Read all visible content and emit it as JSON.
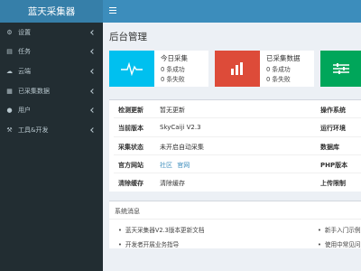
{
  "app": {
    "title": "蓝天采集器"
  },
  "sidebar": {
    "items": [
      {
        "label": "设置",
        "icon": "⚙",
        "icon_name": "gear-icon"
      },
      {
        "label": "任务",
        "icon": "▤",
        "icon_name": "tasks-icon"
      },
      {
        "label": "云端",
        "icon": "☁",
        "icon_name": "cloud-icon"
      },
      {
        "label": "已采集数据",
        "icon": "▦",
        "icon_name": "database-icon"
      },
      {
        "label": "用户",
        "icon": "●",
        "icon_name": "user-icon"
      },
      {
        "label": "工具&开发",
        "icon": "⚒",
        "icon_name": "tools-icon"
      }
    ]
  },
  "main": {
    "page_title": "后台管理",
    "boxes": [
      {
        "title": "今日采集",
        "line1_num": "0",
        "line1_text": "条成功",
        "line2_num": "0",
        "line2_text": "条失败",
        "color": "#00c0ef",
        "icon_name": "pulse-icon"
      },
      {
        "title": "已采集数据",
        "line1_num": "0",
        "line1_text": "条成功",
        "line2_num": "0",
        "line2_text": "条失败",
        "color": "#dd4b39",
        "icon_name": "bar-chart-icon"
      },
      {
        "title": "",
        "color": "#00a65a",
        "icon_name": "sliders-icon"
      }
    ],
    "info": [
      {
        "key": "检测更新",
        "value": "暂无更新",
        "right": "操作系统"
      },
      {
        "key": "当前版本",
        "value": "SkyCaiji V2.3",
        "right": "运行环境"
      },
      {
        "key": "采集状态",
        "value": "未开启自动采集",
        "right": "数据库"
      },
      {
        "key": "官方网站",
        "value1": "社区",
        "value2": "官网",
        "right": "PHP版本"
      },
      {
        "key": "清除缓存",
        "value": "清除缓存",
        "right": "上传限制"
      }
    ],
    "news": {
      "title": "系统消息",
      "items": [
        "蓝天采集器V2.3版本更新文档",
        "新手入门示例",
        "开发者开展业务指导",
        "使用中常见问"
      ]
    }
  }
}
